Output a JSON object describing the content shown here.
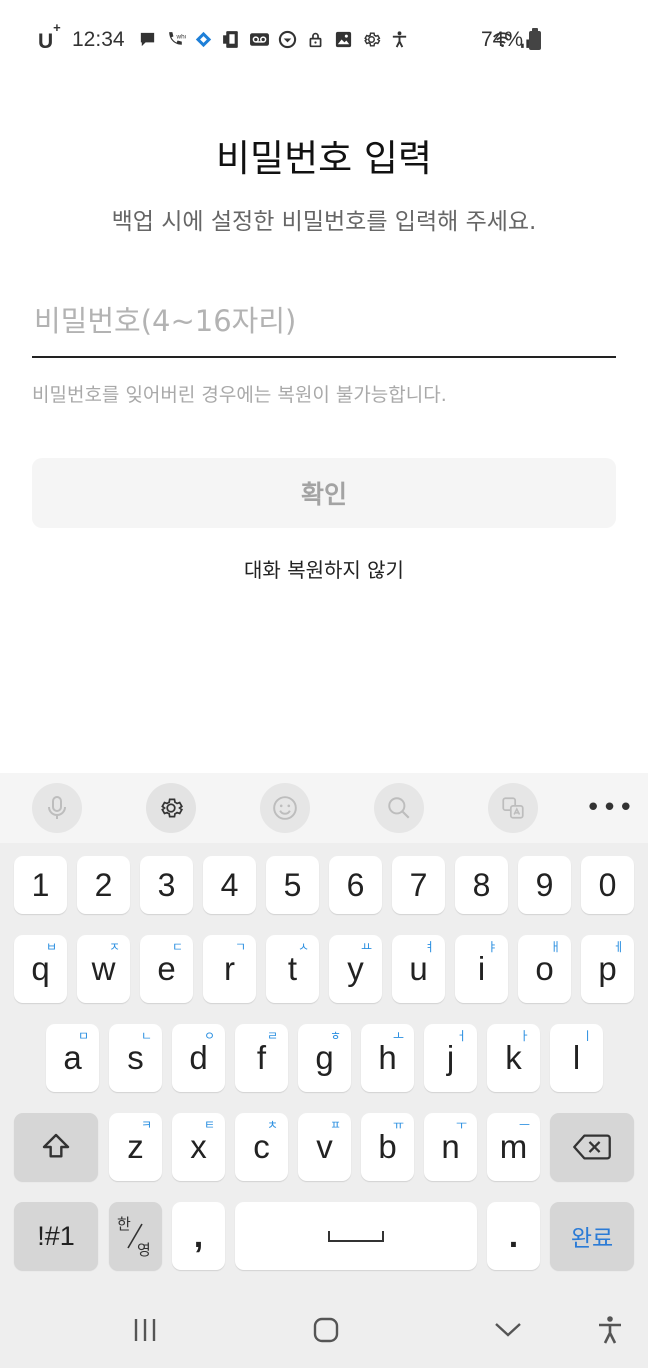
{
  "status_bar": {
    "carrier": "U",
    "carrier_sup": "+",
    "time": "12:34",
    "battery": "74%"
  },
  "page": {
    "title": "비밀번호 입력",
    "subtitle": "백업 시에 설정한 비밀번호를 입력해 주세요.",
    "password_placeholder": "비밀번호(4~16자리)",
    "password_value": "",
    "hint": "비밀번호를 잊어버린 경우에는 복원이 불가능합니다.",
    "confirm_label": "확인",
    "skip_label": "대화 복원하지 않기"
  },
  "keyboard": {
    "number_row": [
      "1",
      "2",
      "3",
      "4",
      "5",
      "6",
      "7",
      "8",
      "9",
      "0"
    ],
    "row1": [
      {
        "key": "q",
        "sub": "ㅂ"
      },
      {
        "key": "w",
        "sub": "ㅈ"
      },
      {
        "key": "e",
        "sub": "ㄷ"
      },
      {
        "key": "r",
        "sub": "ㄱ"
      },
      {
        "key": "t",
        "sub": "ㅅ"
      },
      {
        "key": "y",
        "sub": "ㅛ"
      },
      {
        "key": "u",
        "sub": "ㅕ"
      },
      {
        "key": "i",
        "sub": "ㅑ"
      },
      {
        "key": "o",
        "sub": "ㅐ"
      },
      {
        "key": "p",
        "sub": "ㅔ"
      }
    ],
    "row2": [
      {
        "key": "a",
        "sub": "ㅁ"
      },
      {
        "key": "s",
        "sub": "ㄴ"
      },
      {
        "key": "d",
        "sub": "ㅇ"
      },
      {
        "key": "f",
        "sub": "ㄹ"
      },
      {
        "key": "g",
        "sub": "ㅎ"
      },
      {
        "key": "h",
        "sub": "ㅗ"
      },
      {
        "key": "j",
        "sub": "ㅓ"
      },
      {
        "key": "k",
        "sub": "ㅏ"
      },
      {
        "key": "l",
        "sub": "ㅣ"
      }
    ],
    "row3": [
      {
        "key": "z",
        "sub": "ㅋ"
      },
      {
        "key": "x",
        "sub": "ㅌ"
      },
      {
        "key": "c",
        "sub": "ㅊ"
      },
      {
        "key": "v",
        "sub": "ㅍ"
      },
      {
        "key": "b",
        "sub": "ㅠ"
      },
      {
        "key": "n",
        "sub": "ㅜ"
      },
      {
        "key": "m",
        "sub": "ㅡ"
      }
    ],
    "symbols_label": "!#1",
    "lang_top": "한",
    "lang_bottom": "영",
    "comma": ",",
    "period": ".",
    "done_label": "완료",
    "accent_color": "#2b8fe0"
  }
}
